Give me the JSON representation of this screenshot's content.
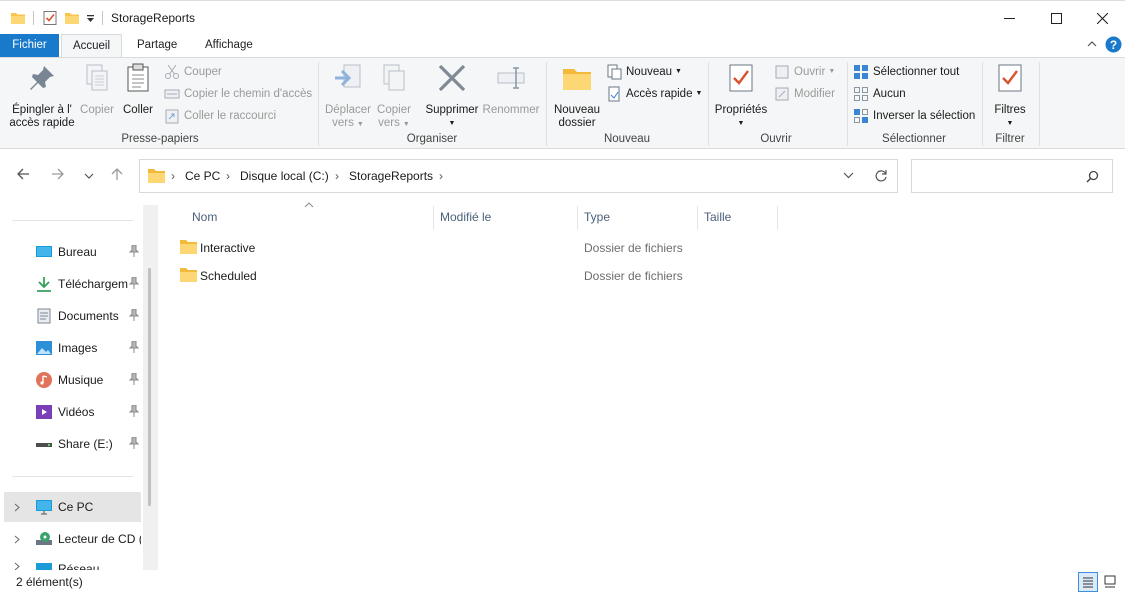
{
  "window": {
    "title": "StorageReports",
    "controls": {
      "minimize": "—",
      "maximize": "☐",
      "close": "✕"
    }
  },
  "ribbon_tabs": [
    "Fichier",
    "Accueil",
    "Partage",
    "Affichage"
  ],
  "ribbon": {
    "clipboard": {
      "label": "Presse-papiers",
      "pin_line1": "Épingler à l'",
      "pin_line2": "accès rapide",
      "copy": "Copier",
      "paste": "Coller",
      "cut": "Couper",
      "copy_path": "Copier le chemin d'accès",
      "paste_shortcut": "Coller le raccourci"
    },
    "organize": {
      "label": "Organiser",
      "move_line1": "Déplacer",
      "move_line2": "vers",
      "copyto_line1": "Copier",
      "copyto_line2": "vers",
      "delete": "Supprimer",
      "rename": "Renommer"
    },
    "new": {
      "label": "Nouveau",
      "new_folder_line1": "Nouveau",
      "new_folder_line2": "dossier",
      "new_item": "Nouveau",
      "easy_access": "Accès rapide"
    },
    "open": {
      "label": "Ouvrir",
      "properties": "Propriétés",
      "open": "Ouvrir",
      "edit": "Modifier"
    },
    "select": {
      "label": "Sélectionner",
      "select_all": "Sélectionner tout",
      "select_none": "Aucun",
      "invert": "Inverser la sélection"
    },
    "filter": {
      "label": "Filtrer",
      "filters": "Filtres"
    }
  },
  "address": {
    "crumbs": [
      "Ce PC",
      "Disque local (C:)",
      "StorageReports"
    ],
    "search_placeholder": ""
  },
  "nav_pane": {
    "quick_access": [
      {
        "label": "Bureau",
        "icon": "desktop-icon",
        "pinned": true
      },
      {
        "label": "Téléchargem",
        "icon": "download-icon",
        "pinned": true
      },
      {
        "label": "Documents",
        "icon": "documents-icon",
        "pinned": true
      },
      {
        "label": "Images",
        "icon": "pictures-icon",
        "pinned": true
      },
      {
        "label": "Musique",
        "icon": "music-icon",
        "pinned": true
      },
      {
        "label": "Vidéos",
        "icon": "videos-icon",
        "pinned": true
      },
      {
        "label": "Share (E:)",
        "icon": "network-drive-icon",
        "pinned": true
      }
    ],
    "tree": [
      {
        "label": "Ce PC",
        "icon": "computer-icon",
        "selected": true
      },
      {
        "label": "Lecteur de CD (D",
        "icon": "cd-drive-icon",
        "selected": false
      },
      {
        "label": "Réseau",
        "icon": "network-icon",
        "selected": false
      }
    ]
  },
  "file_list": {
    "columns": [
      "Nom",
      "Modifié le",
      "Type",
      "Taille"
    ],
    "rows": [
      {
        "name": "Interactive",
        "modified": "",
        "type": "Dossier de fichiers",
        "size": ""
      },
      {
        "name": "Scheduled",
        "modified": "",
        "type": "Dossier de fichiers",
        "size": ""
      }
    ]
  },
  "status": {
    "item_count": "2 élément(s)"
  },
  "colors": {
    "file_tab": "#1979ca",
    "folder": "#f8c44f",
    "selected_nav": "#e5e5e5",
    "header_text": "#4c607a"
  }
}
